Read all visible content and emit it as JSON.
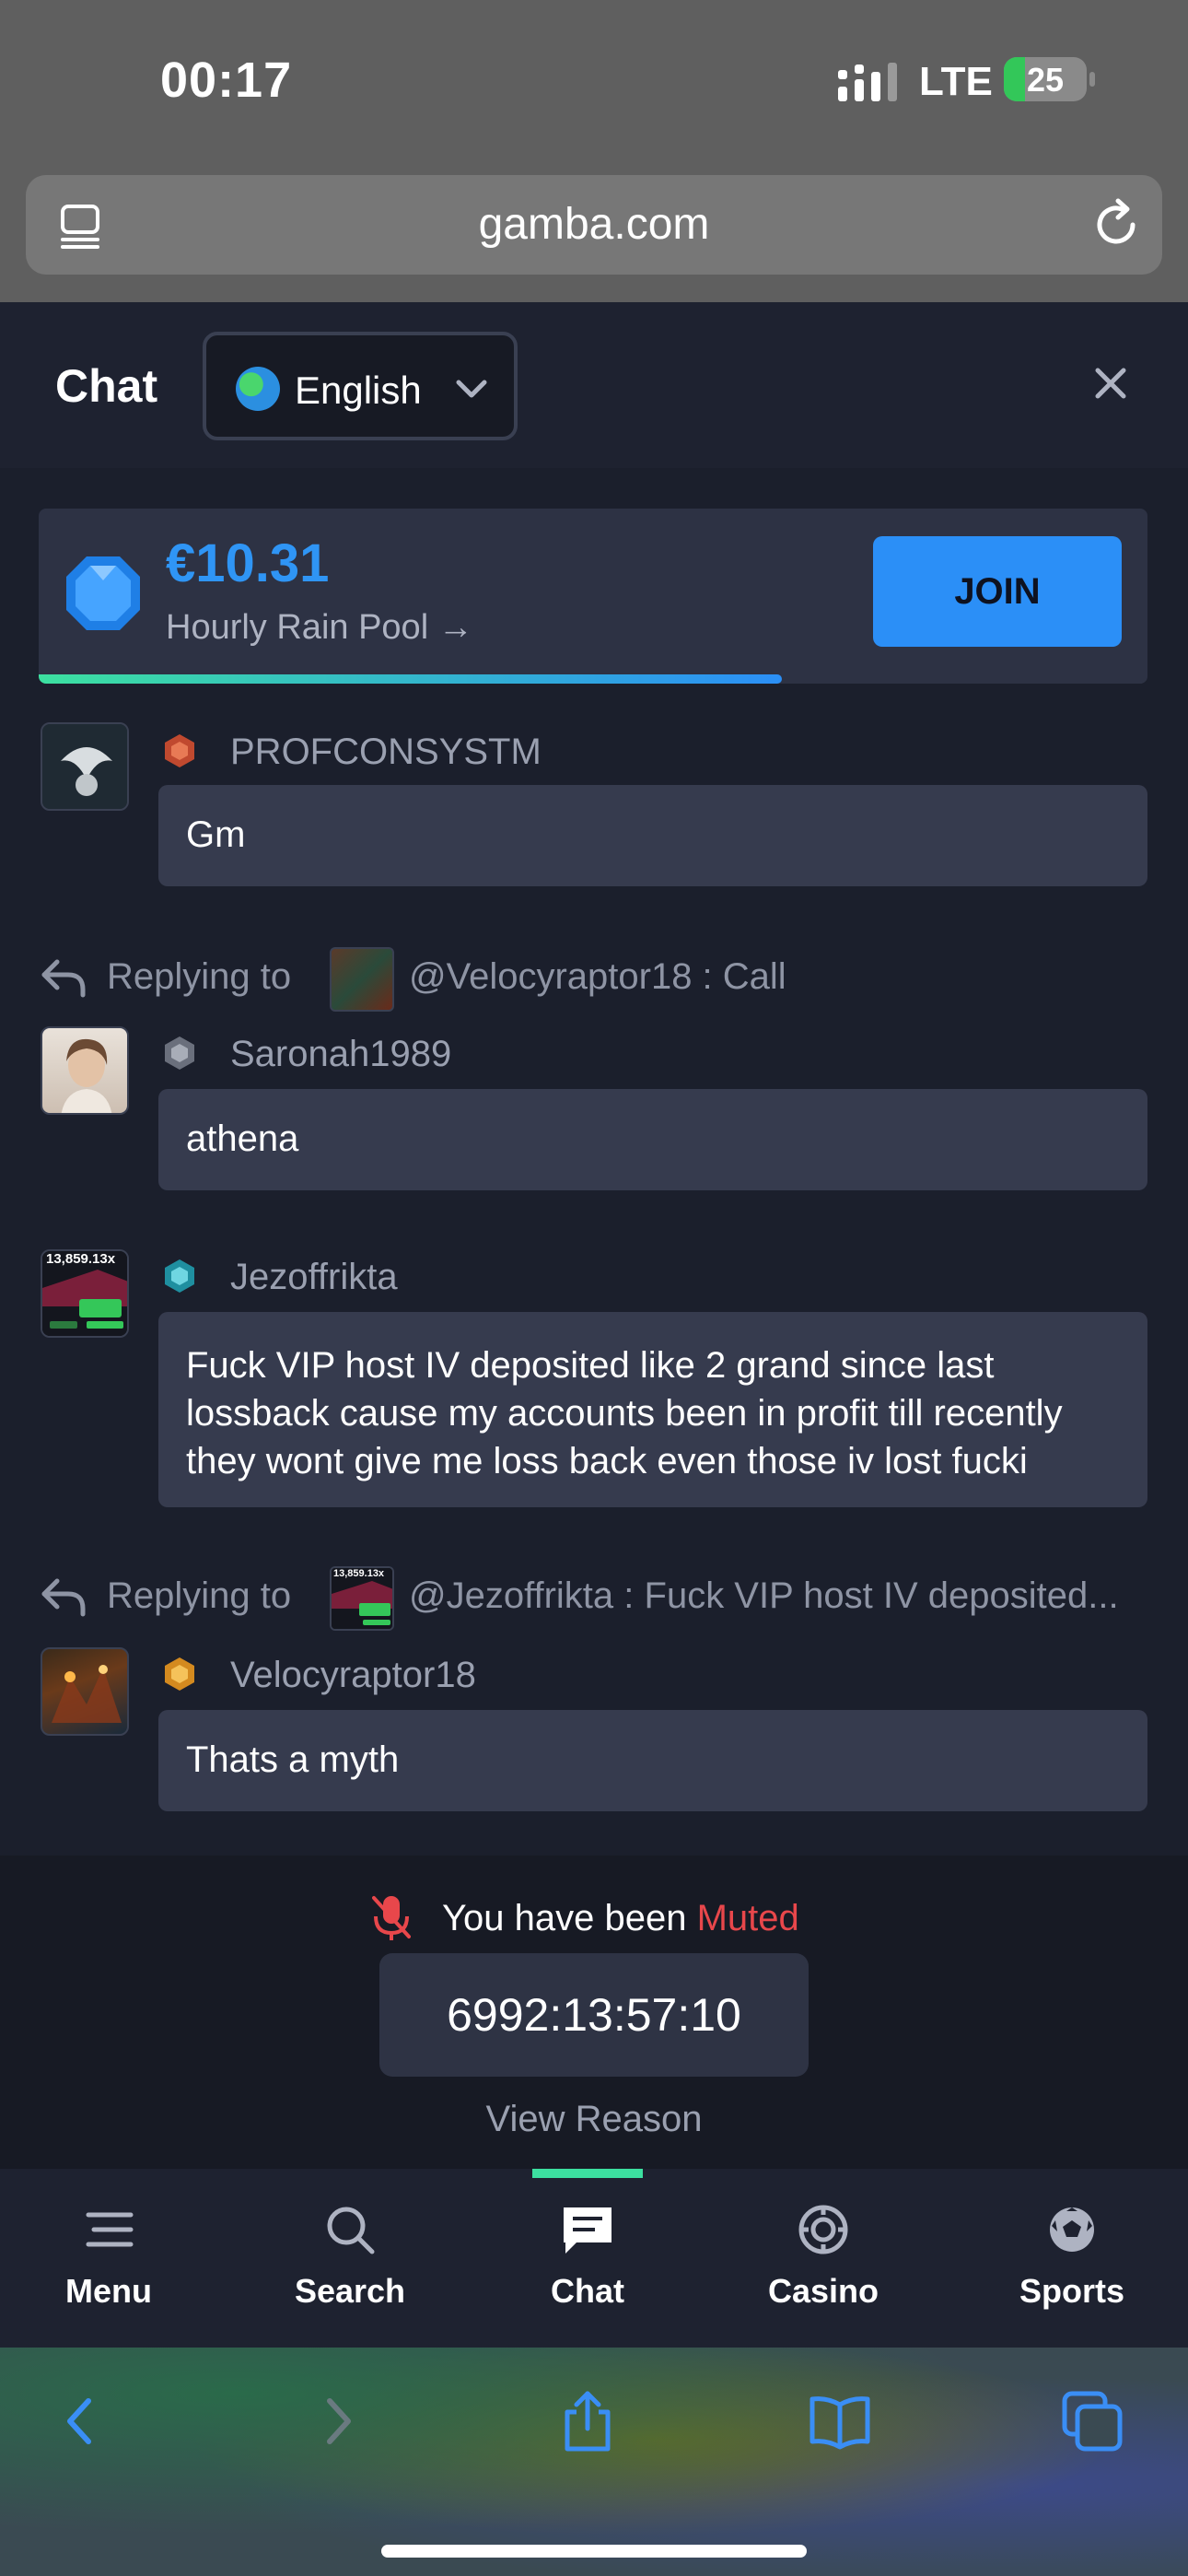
{
  "status_bar": {
    "time": "00:17",
    "network": "LTE",
    "battery": "25",
    "battery_percent": 25
  },
  "browser": {
    "url": "gamba.com"
  },
  "chat_header": {
    "title": "Chat",
    "language": "English"
  },
  "rain_pool": {
    "amount": "€10.31",
    "label": "Hourly Rain Pool →",
    "join_label": "JOIN",
    "progress_fraction": 0.67
  },
  "messages": [
    {
      "username": "PROFCONSYSTM",
      "text": "Gm"
    },
    {
      "reply": {
        "label": "Replying to",
        "text": "@Velocyraptor18 : Call"
      },
      "username": "Saronah1989",
      "text": "athena"
    },
    {
      "username": "Jezoffrikta",
      "avatar_caption": "13,859.13x",
      "text": "Fuck VIP host IV deposited like 2 grand since last lossback cause my accounts been in profit till recently they wont give me loss back even those iv lost fucki"
    },
    {
      "reply": {
        "label": "Replying to",
        "text": "@Jezoffrikta : Fuck VIP host IV deposited...",
        "thumb_caption": "13,859.13x"
      },
      "username": "Velocyraptor18",
      "text": "Thats a myth"
    }
  ],
  "muted": {
    "prefix": "You have been ",
    "word": "Muted",
    "timer": "6992:13:57:10",
    "view_reason": "View Reason"
  },
  "bottom_nav": [
    {
      "label": "Menu",
      "icon": "menu-icon"
    },
    {
      "label": "Search",
      "icon": "search-icon"
    },
    {
      "label": "Chat",
      "icon": "chat-icon",
      "active": true
    },
    {
      "label": "Casino",
      "icon": "casino-chip-icon"
    },
    {
      "label": "Sports",
      "icon": "soccer-ball-icon"
    }
  ],
  "colors": {
    "accent_blue": "#2b8ff7",
    "active_green": "#3ce0a0",
    "muted_red": "#e8474b",
    "background": "#1b1f2c",
    "bubble": "#363b4e"
  }
}
